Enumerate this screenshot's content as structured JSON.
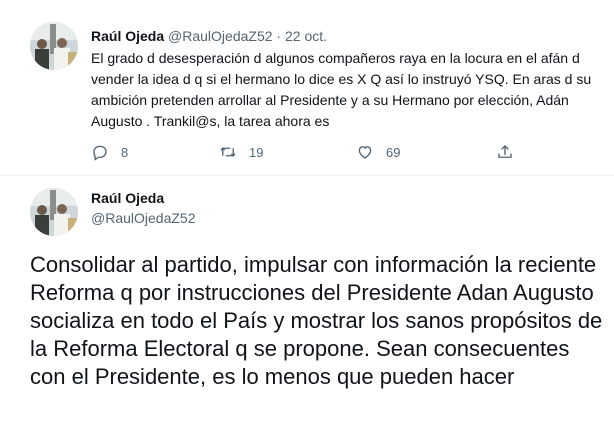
{
  "tweet1": {
    "author_name": "Raúl Ojeda",
    "handle": "@RaulOjedaZ52",
    "separator": "·",
    "date": "22 oct.",
    "text": "El grado d desesperación d algunos compañeros raya en la locura en el afán d vender la idea d q si el hermano lo dice es X Q así lo instruyó YSQ. En aras d su ambición pretenden arrollar al Presidente y a su Hermano por elección, Adán Augusto . Trankil@s, la tarea ahora es",
    "actions": {
      "reply_count": "8",
      "retweet_count": "19",
      "like_count": "69"
    },
    "icons": {
      "reply": "reply-icon",
      "retweet": "retweet-icon",
      "like": "heart-icon",
      "share": "share-icon"
    }
  },
  "tweet2": {
    "author_name": "Raúl Ojeda",
    "handle": "@RaulOjedaZ52",
    "text": "Consolidar al partido, impulsar con información la reciente Reforma q por instrucciones del Presidente Adan Augusto socializa en todo el País y mostrar los sanos propósitos de la Reforma Electoral q se propone. Sean consecuentes con el Presidente, es lo menos que pueden hacer"
  },
  "colors": {
    "text": "#0f1419",
    "muted": "#536471",
    "divider": "#eff3f4"
  }
}
